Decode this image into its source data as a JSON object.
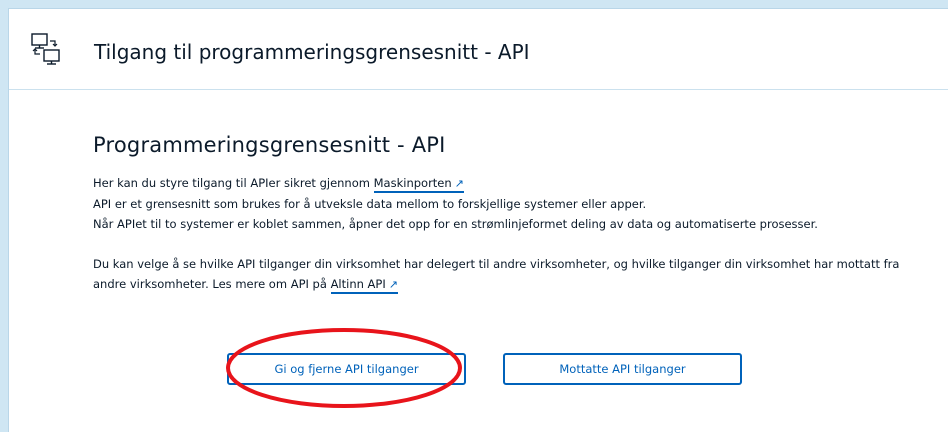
{
  "header": {
    "title": "Tilgang til programmeringsgrensesnitt - API",
    "icon": "computers-network-icon"
  },
  "main": {
    "section_title": "Programmeringsgrensesnitt - API",
    "intro_prefix": "Her kan du styre tilgang til APIer sikret gjennom",
    "maskinporten_link": "Maskinporten",
    "line2": "API er et grensesnitt som brukes for å utveksle data mellom to forskjellige systemer eller apper.",
    "line3": "Når APIet til to systemer er koblet sammen, åpner det opp for en strømlinjeformet deling av data og automatiserte prosesser.",
    "line4": "Du kan velge å se hvilke API tilganger din virksomhet har delegert til andre virksomheter, og hvilke tilganger din virksomhet har mottatt fra",
    "line5_prefix": "andre virksomheter. Les mere om API på",
    "altinn_link": "Altinn API",
    "external_arrow": "↗"
  },
  "buttons": {
    "give_remove": "Gi og fjerne API tilganger",
    "received": "Mottatte API tilganger"
  },
  "colors": {
    "accent": "#0062ba",
    "annotation": "#e8141b"
  }
}
